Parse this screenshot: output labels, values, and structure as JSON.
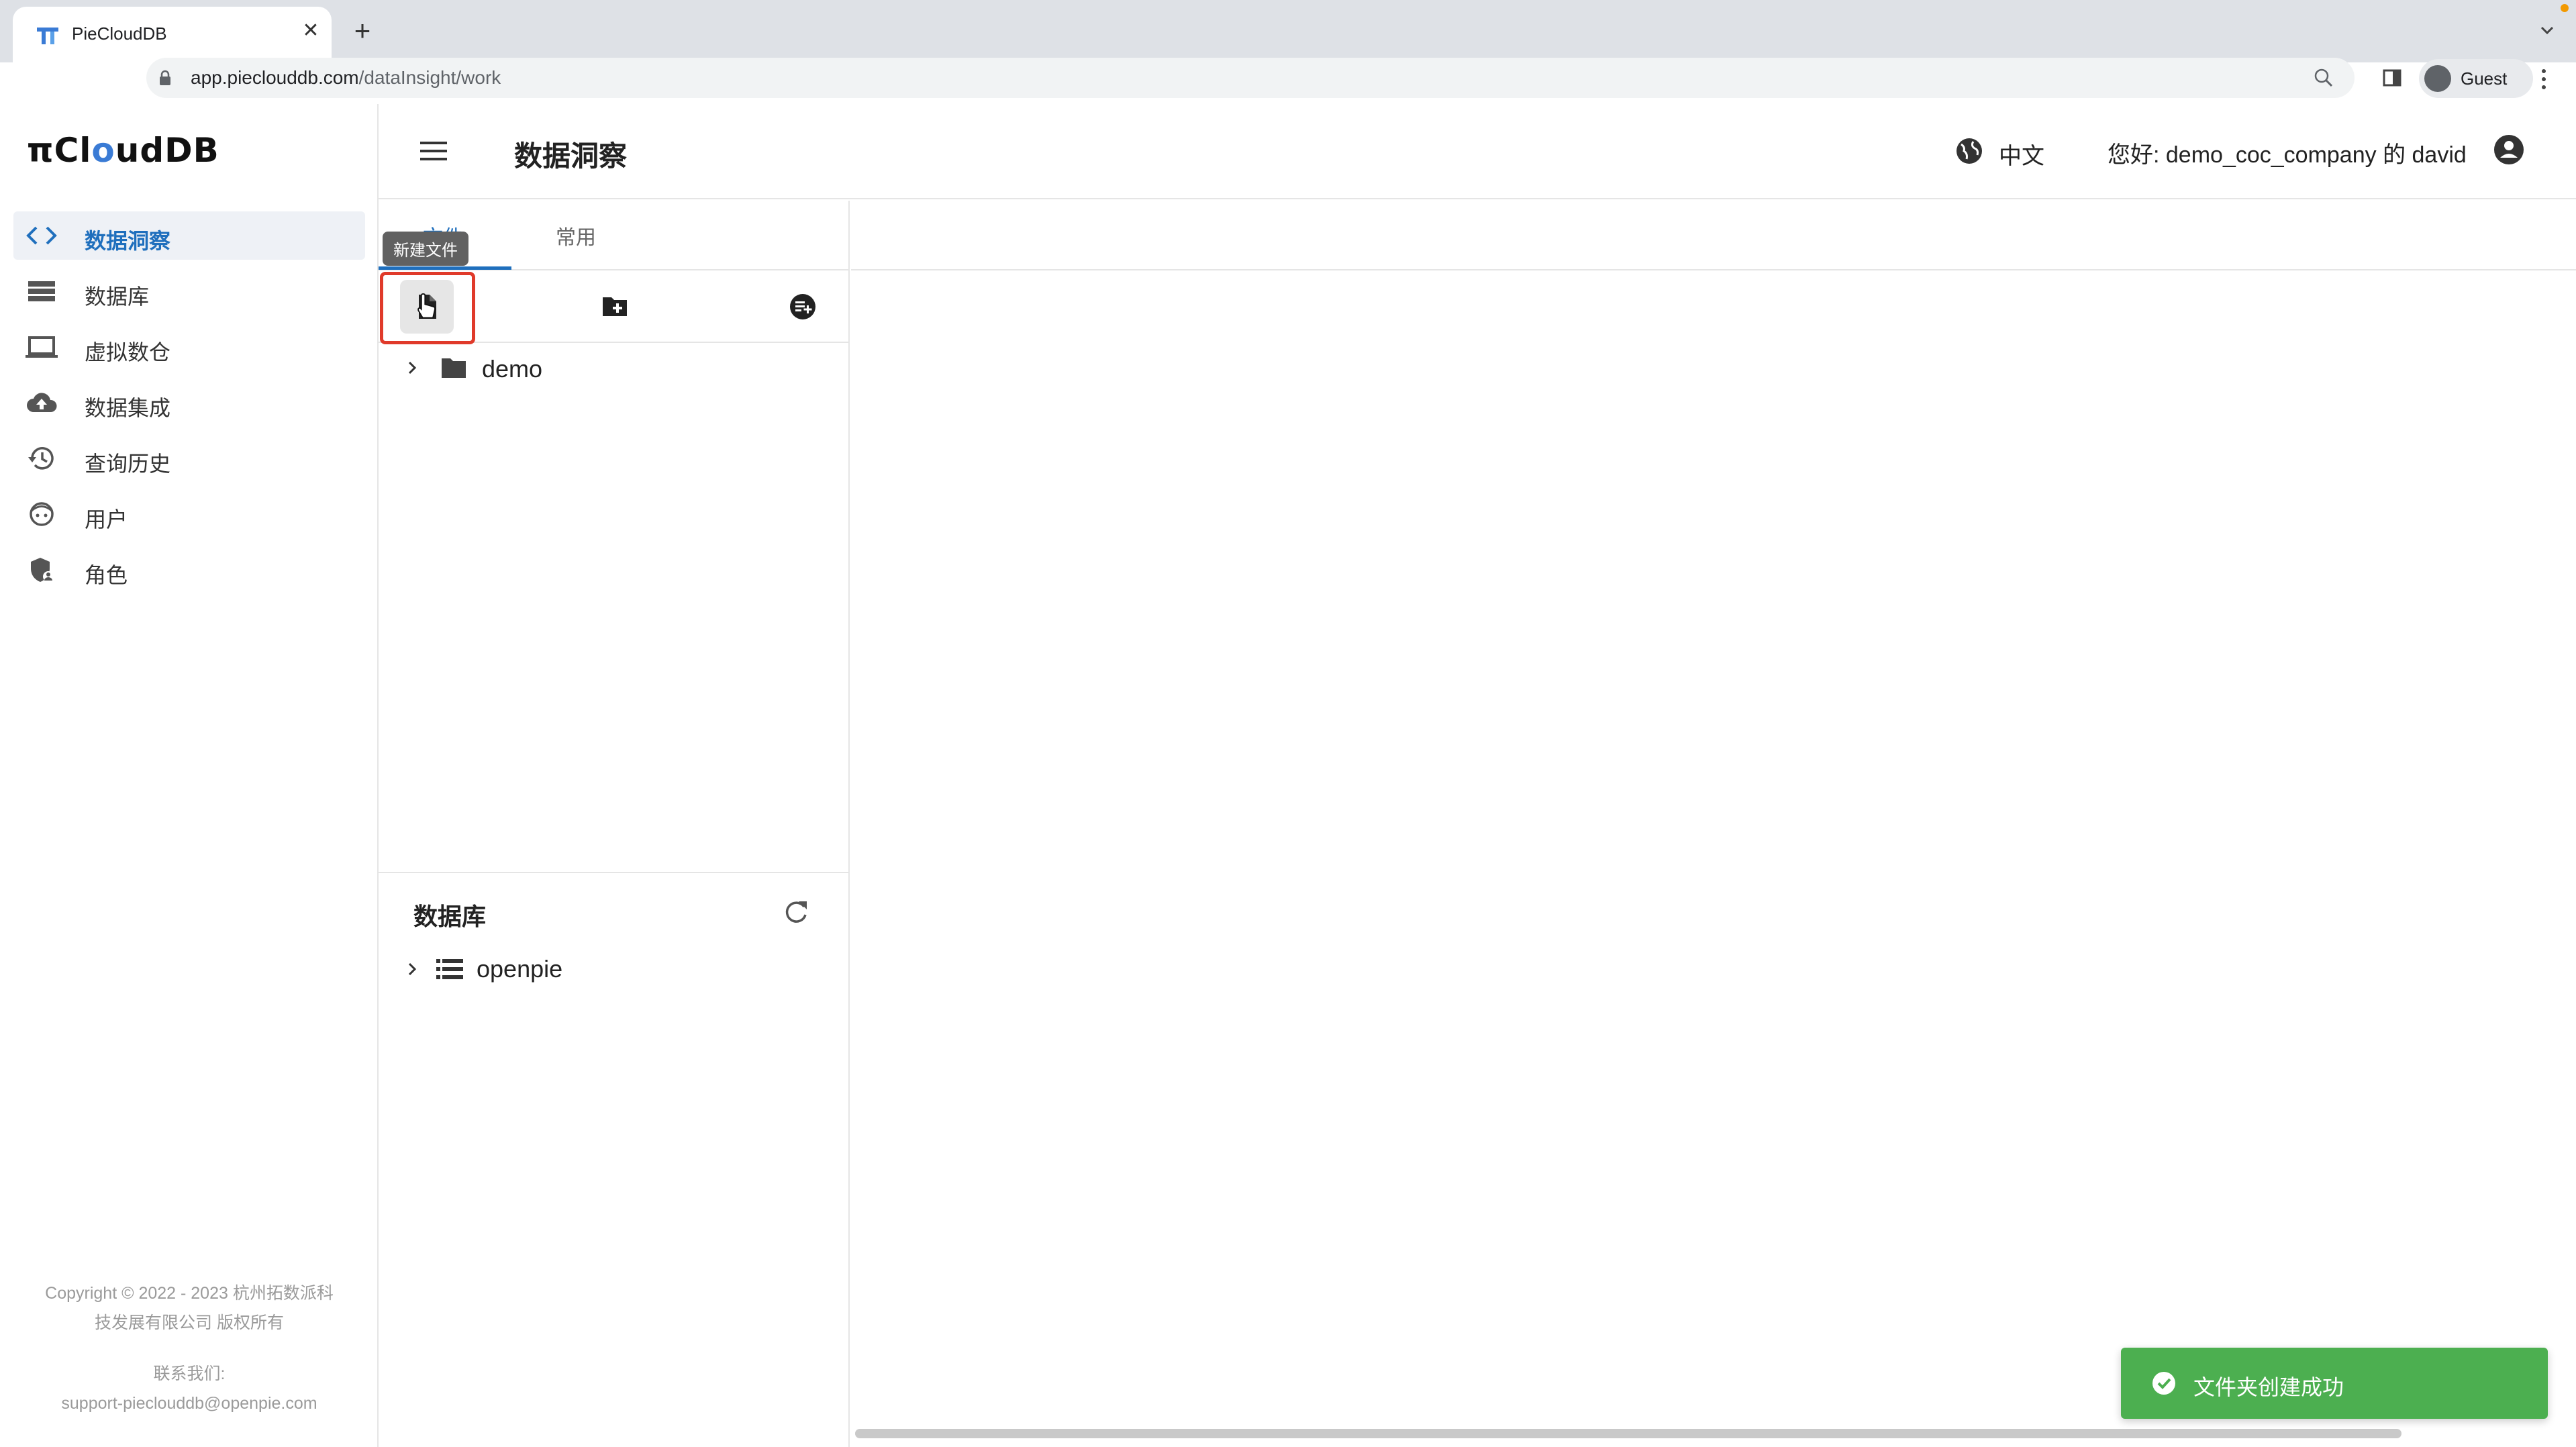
{
  "browser": {
    "tab_title": "PieCloudDB",
    "url_host": "app.pieclouddb.com",
    "url_path": "/dataInsight/work",
    "profile_label": "Guest"
  },
  "app": {
    "brand": {
      "prefix": "π",
      "c": "Cl",
      "o": "o",
      "rest": "udDB"
    },
    "page_title": "数据洞察",
    "language": "中文",
    "greeting": "您好: demo_coc_company 的 david",
    "sidebar": {
      "items": [
        {
          "label": "数据洞察",
          "icon": "code-icon",
          "active": true
        },
        {
          "label": "数据库",
          "icon": "database-list-icon",
          "active": false
        },
        {
          "label": "虚拟数仓",
          "icon": "laptop-icon",
          "active": false
        },
        {
          "label": "数据集成",
          "icon": "cloud-upload-icon",
          "active": false
        },
        {
          "label": "查询历史",
          "icon": "history-icon",
          "active": false
        },
        {
          "label": "用户",
          "icon": "face-icon",
          "active": false
        },
        {
          "label": "角色",
          "icon": "shield-user-icon",
          "active": false
        }
      ],
      "copyright_line1": "Copyright © 2022 - 2023 杭州拓数派科",
      "copyright_line2": "技发展有限公司 版权所有",
      "contact_line1": "联系我们:",
      "contact_line2": "support-pieclouddb@openpie.com"
    },
    "file_panel": {
      "tabs": [
        {
          "label": "文件",
          "active": true
        },
        {
          "label": "常用",
          "active": false
        }
      ],
      "tooltip": "新建文件",
      "actions": [
        "new-file-icon",
        "new-folder-icon",
        "new-query-icon"
      ],
      "tree": [
        {
          "label": "demo",
          "type": "folder"
        }
      ]
    },
    "database_panel": {
      "title": "数据库",
      "items": [
        {
          "label": "openpie"
        }
      ]
    },
    "toast": {
      "message": "文件夹创建成功",
      "color": "#4caf50"
    },
    "accent_color": "#1f6fbd"
  }
}
